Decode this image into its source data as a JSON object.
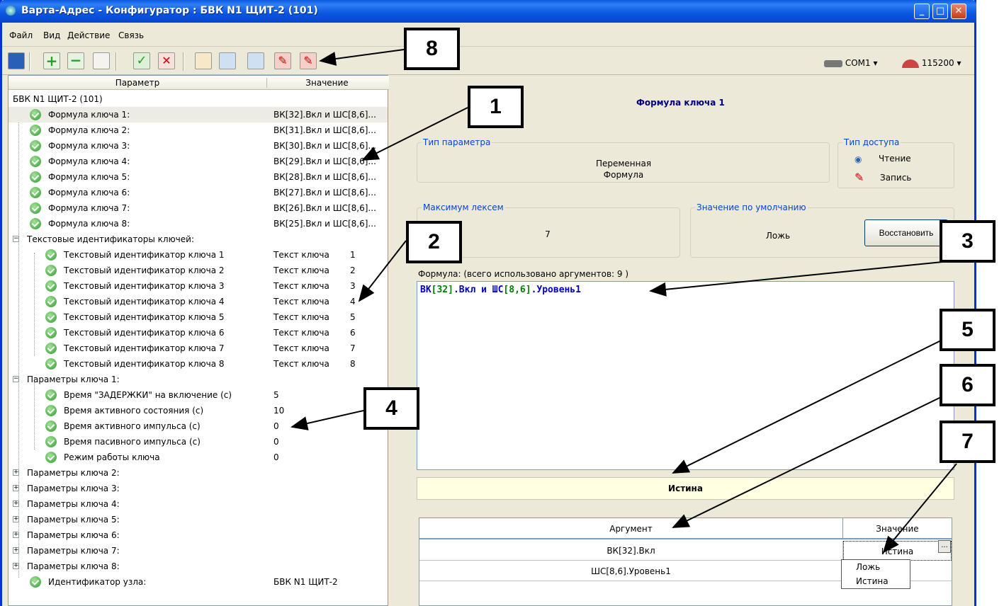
{
  "window": {
    "title": "Варта-Адрес - Конфигуратор : БВК N1 ЩИТ-2 (101)"
  },
  "menu": [
    "Файл",
    "Вид",
    "Действие",
    "Связь"
  ],
  "toolbar": {
    "port": "COM1",
    "speed": "115200"
  },
  "tree": {
    "header": {
      "param": "Параметр",
      "value": "Значение"
    },
    "root": "БВК N1 ЩИТ-2 (101)",
    "formulas": [
      {
        "label": "Формула ключа 1:",
        "value": "ВК[32].Вкл и ШС[8,6]..."
      },
      {
        "label": "Формула ключа 2:",
        "value": "ВК[31].Вкл и ШС[8,6]..."
      },
      {
        "label": "Формула ключа 3:",
        "value": "ВК[30].Вкл и ШС[8,6]..."
      },
      {
        "label": "Формула ключа 4:",
        "value": "ВК[29].Вкл и ШС[8,6]..."
      },
      {
        "label": "Формула ключа 5:",
        "value": "ВК[28].Вкл и ШС[8,6]..."
      },
      {
        "label": "Формула ключа 6:",
        "value": "ВК[27].Вкл и ШС[8,6]..."
      },
      {
        "label": "Формула ключа 7:",
        "value": "ВК[26].Вкл и ШС[8,6]..."
      },
      {
        "label": "Формула ключа 8:",
        "value": "ВК[25].Вкл и ШС[8,6]..."
      }
    ],
    "text_ids_group": "Текстовые идентификаторы ключей:",
    "text_ids": [
      {
        "label": "Текстовый идентификатор ключа 1",
        "value": "Текст ключа",
        "num": "1"
      },
      {
        "label": "Текстовый идентификатор ключа 2",
        "value": "Текст ключа",
        "num": "2"
      },
      {
        "label": "Текстовый идентификатор ключа 3",
        "value": "Текст ключа",
        "num": "3"
      },
      {
        "label": "Текстовый идентификатор ключа 4",
        "value": "Текст ключа",
        "num": "4"
      },
      {
        "label": "Текстовый идентификатор ключа 5",
        "value": "Текст ключа",
        "num": "5"
      },
      {
        "label": "Текстовый идентификатор ключа 6",
        "value": "Текст ключа",
        "num": "6"
      },
      {
        "label": "Текстовый идентификатор ключа 7",
        "value": "Текст ключа",
        "num": "7"
      },
      {
        "label": "Текстовый идентификатор ключа 8",
        "value": "Текст ключа",
        "num": "8"
      }
    ],
    "key1_group": "Параметры ключа 1:",
    "key1_params": [
      {
        "label": "Время \"ЗАДЕРЖКИ\"  на включение (с)",
        "value": "5"
      },
      {
        "label": "Время активного состояния (с)",
        "value": "10"
      },
      {
        "label": "Время активного импульса (с)",
        "value": "0"
      },
      {
        "label": "Время пасивного импульса (с)",
        "value": "0"
      },
      {
        "label": "Режим работы ключа",
        "value": "0"
      }
    ],
    "collapsed_groups": [
      "Параметры ключа 2:",
      "Параметры ключа 3:",
      "Параметры ключа 4:",
      "Параметры ключа 5:",
      "Параметры ключа 6:",
      "Параметры ключа 7:",
      "Параметры ключа 8:"
    ],
    "node_id": {
      "label": "Идентификатор узла:",
      "value": "БВК N1 ЩИТ-2"
    }
  },
  "detail": {
    "title": "Формула ключа 1",
    "param_type_legend": "Тип параметра",
    "param_type_1": "Переменная",
    "param_type_2": "Формула",
    "access_legend": "Тип доступа",
    "access_read": "Чтение",
    "access_write": "Запись",
    "max_lex_legend": "Максимум лексем",
    "max_lex": "7",
    "default_legend": "Значение по умолчанию",
    "default_value": "Ложь",
    "restore_button": "Восстановить",
    "formula_label": "Формула: (всего использовано аргументов: 9 )",
    "formula_parts": [
      "ВК",
      "[32]",
      ".Вкл",
      " и ",
      "ШС",
      "[8,6]",
      ".Уровень1"
    ],
    "result": "Истина",
    "args_header": {
      "arg": "Аргумент",
      "value": "Значение"
    },
    "args": [
      {
        "arg": "ВК[32].Вкл",
        "value": "Истина"
      },
      {
        "arg": "ШС[8,6].Уровень1",
        "value": ""
      }
    ],
    "popup": [
      "Ложь",
      "Истина"
    ]
  },
  "callouts": [
    "1",
    "2",
    "3",
    "4",
    "5",
    "6",
    "7",
    "8"
  ],
  "colors": {
    "titlebar": "#0a5be0",
    "callout_border": "#000000",
    "formula_blue": "#0000c0",
    "formula_green": "#008000"
  }
}
